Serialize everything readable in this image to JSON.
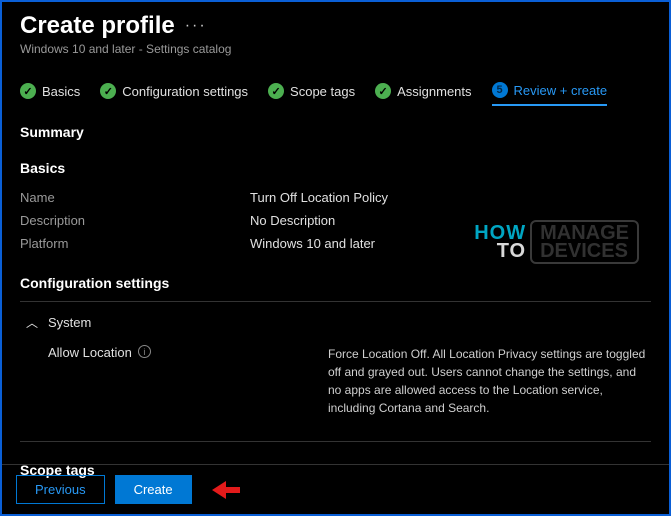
{
  "header": {
    "title": "Create profile",
    "subtitle": "Windows 10 and later - Settings catalog"
  },
  "tabs": [
    {
      "label": "Basics",
      "state": "done"
    },
    {
      "label": "Configuration settings",
      "state": "done"
    },
    {
      "label": "Scope tags",
      "state": "done"
    },
    {
      "label": "Assignments",
      "state": "done"
    },
    {
      "label": "Review + create",
      "state": "active"
    }
  ],
  "summary_heading": "Summary",
  "basics": {
    "heading": "Basics",
    "rows": [
      {
        "label": "Name",
        "value": "Turn Off Location Policy"
      },
      {
        "label": "Description",
        "value": "No Description"
      },
      {
        "label": "Platform",
        "value": "Windows 10 and later"
      }
    ]
  },
  "config": {
    "heading": "Configuration settings",
    "group": "System",
    "setting_label": "Allow Location",
    "setting_desc": "Force Location Off. All Location Privacy settings are toggled off and grayed out. Users cannot change the settings, and no apps are allowed access to the Location service, including Cortana and Search."
  },
  "scope_heading": "Scope tags",
  "footer": {
    "previous": "Previous",
    "create": "Create"
  },
  "watermark": {
    "l1": "HOW",
    "l2": "TO",
    "r1": "MANAGE",
    "r2": "DEVICES"
  }
}
